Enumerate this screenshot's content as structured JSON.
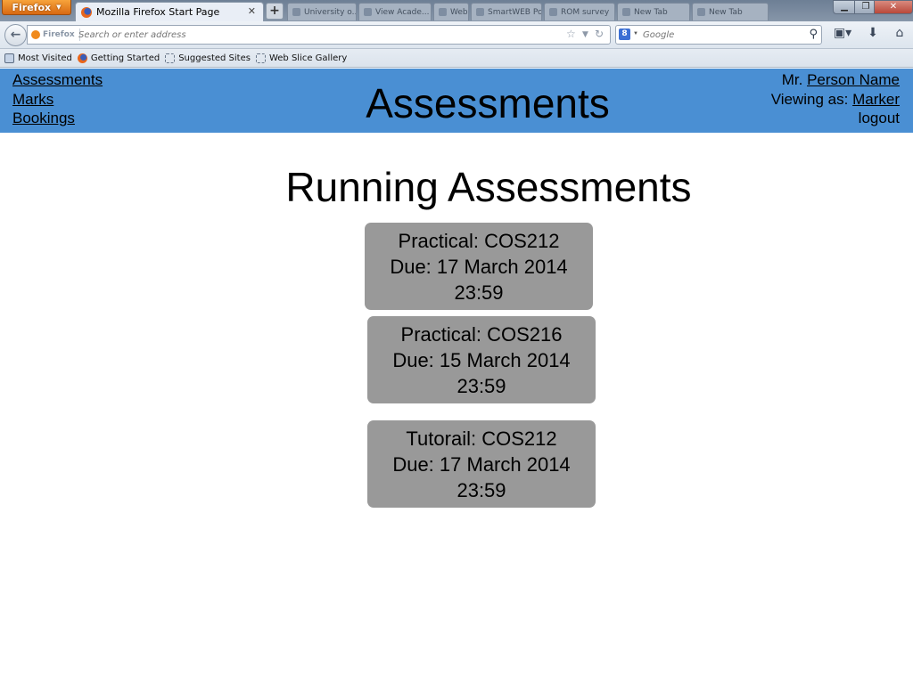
{
  "browser": {
    "app_button": "Firefox",
    "active_tab_title": "Mozilla Firefox Start Page",
    "background_tabs": [
      "University o...",
      "View Acade...",
      "Web",
      "SmartWEB Po...",
      "ROM survey",
      "New Tab",
      "New Tab"
    ],
    "identity_label": "Firefox",
    "url_placeholder": "Search or enter address",
    "search_placeholder": "Google",
    "search_engine_letter": "8",
    "bookmarks": [
      "Most Visited",
      "Getting Started",
      "Suggested Sites",
      "Web Slice Gallery"
    ]
  },
  "header": {
    "nav": [
      "Assessments",
      "Marks",
      "Bookings"
    ],
    "title": "Assessments",
    "user_prefix": "Mr.",
    "user_name": "Person Name",
    "viewing_as_label": "Viewing as:",
    "role": "Marker",
    "logout": "logout",
    "bar_color": "#4a8fd3"
  },
  "main": {
    "title": "Running Assessments",
    "card_color": "#999999",
    "assessments": [
      {
        "name": "Practical: COS212",
        "due": "Due: 17 March 2014",
        "time": "23:59"
      },
      {
        "name": "Practical: COS216",
        "due": "Due: 15 March 2014",
        "time": "23:59"
      },
      {
        "name": "Tutorail: COS212",
        "due": "Due: 17 March 2014",
        "time": "23:59"
      }
    ]
  }
}
